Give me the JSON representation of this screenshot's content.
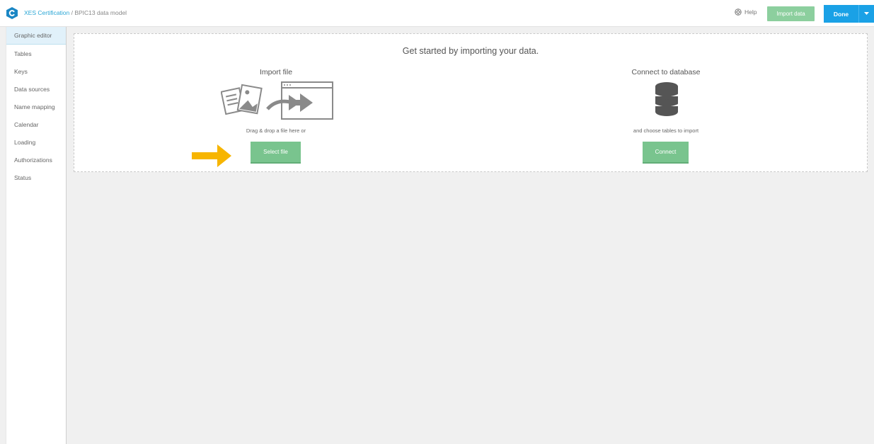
{
  "header": {
    "project_link": "XES Certification",
    "separator": " / ",
    "current_page": "BPIC13 data model",
    "help_label": "Help",
    "import_label": "Import data",
    "done_label": "Done"
  },
  "sidebar": {
    "items": [
      {
        "label": "Graphic editor",
        "active": true
      },
      {
        "label": "Tables"
      },
      {
        "label": "Keys"
      },
      {
        "label": "Data sources"
      },
      {
        "label": "Name mapping"
      },
      {
        "label": "Calendar"
      },
      {
        "label": "Loading"
      },
      {
        "label": "Authorizations"
      },
      {
        "label": "Status"
      }
    ]
  },
  "main": {
    "title": "Get started by importing your data.",
    "import_file": {
      "heading": "Import file",
      "subtitle": "Drag & drop a file here or",
      "button": "Select file"
    },
    "connect_db": {
      "heading": "Connect to database",
      "subtitle": "and choose tables to import",
      "button": "Connect"
    }
  },
  "colors": {
    "accent": "#1aa1e6",
    "green": "#79c48e",
    "arrow": "#f7b500"
  }
}
